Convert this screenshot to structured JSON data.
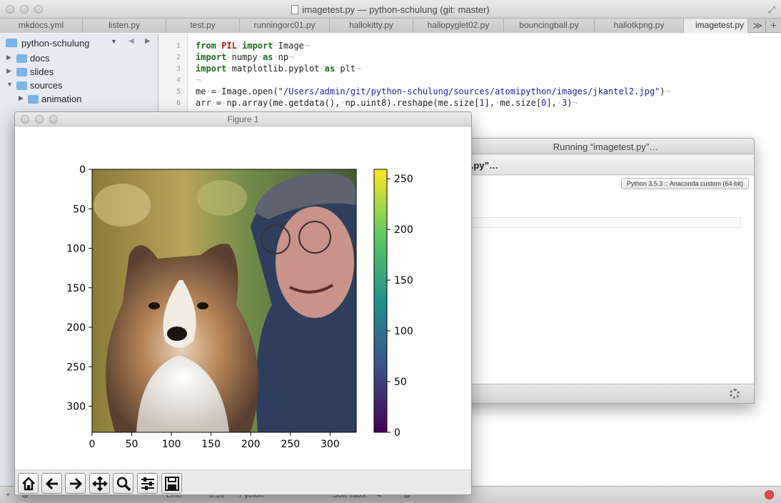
{
  "editor": {
    "window_title": "imagetest.py — python-schulung (git: master)",
    "tabs": [
      {
        "label": "mkdocs.yml"
      },
      {
        "label": "listen.py"
      },
      {
        "label": "test.py"
      },
      {
        "label": "runningorc01.py"
      },
      {
        "label": "hallokitty.py"
      },
      {
        "label": "hallopyglet02.py"
      },
      {
        "label": "bouncingball.py"
      },
      {
        "label": "hallotkpng.py"
      },
      {
        "label": "imagetest.py",
        "active": true
      }
    ],
    "tab_overflow": "≫",
    "tab_add": "+",
    "sidebar": {
      "project": "python-schulung",
      "tree": [
        {
          "label": "docs",
          "expanded": false
        },
        {
          "label": "slides",
          "expanded": false
        },
        {
          "label": "sources",
          "expanded": true
        },
        {
          "label": "animation",
          "expanded": false
        }
      ]
    },
    "code": {
      "line_numbers": [
        "1",
        "2",
        "3",
        "4",
        "5",
        "6"
      ],
      "lines": [
        "from PIL import Image",
        "import numpy as np",
        "import matplotlib.pyplot as plt",
        "",
        "me = Image.open(\"/Users/admin/git/python-schulung/sources/atomipython/images/jkantel2.jpg\")",
        "arr = np.array(me.getdata(), np.uint8).reshape(me.size[1], me.size[0], 3)"
      ]
    },
    "statusbar": {
      "line_label": "Line:",
      "line_value": "8:16",
      "language": "Python",
      "tabs_label": "Soft Tabs:",
      "tabs_value": "4"
    }
  },
  "runner": {
    "title": "Running “imagetest.py”…",
    "heading": "est.py”…",
    "python_version": "Python 3.5.3 :: Anaconda custom (64-bit)"
  },
  "figure": {
    "title": "Figure 1",
    "toolbar": [
      {
        "name": "home-icon"
      },
      {
        "name": "back-arrow-icon"
      },
      {
        "name": "forward-arrow-icon"
      },
      {
        "name": "pan-icon"
      },
      {
        "name": "zoom-icon"
      },
      {
        "name": "configure-subplots-icon"
      },
      {
        "name": "save-icon"
      }
    ]
  },
  "chart_data": {
    "type": "heatmap",
    "description_source": "image shown via plt.imshow with viridis colorbar",
    "xticks": [
      0,
      50,
      100,
      150,
      200,
      250,
      300
    ],
    "yticks": [
      0,
      50,
      100,
      150,
      200,
      250,
      300
    ],
    "xlim": [
      0,
      333
    ],
    "ylim": [
      333,
      0
    ],
    "colorbar": {
      "colormap": "viridis",
      "ticks": [
        0,
        50,
        100,
        150,
        200,
        250
      ],
      "range": [
        0,
        255
      ]
    },
    "colors": [
      "#440154",
      "#3b528b",
      "#21918c",
      "#5ec962",
      "#fde725"
    ]
  }
}
